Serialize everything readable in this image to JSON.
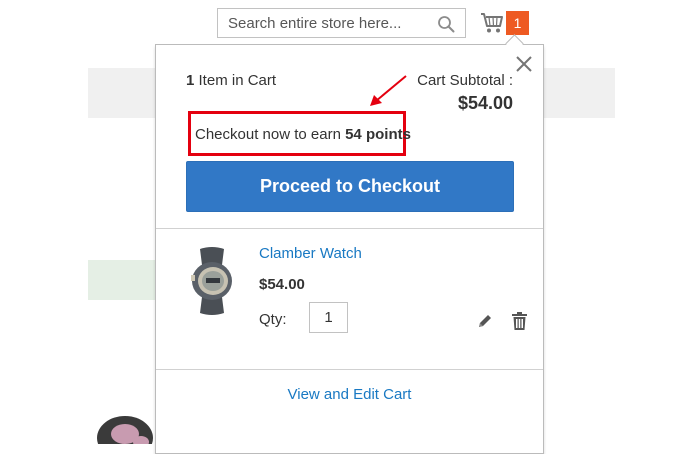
{
  "search": {
    "placeholder": "Search entire store here..."
  },
  "cart": {
    "badge_count": "1"
  },
  "minicart": {
    "items_count_number": "1",
    "items_count_label": "Item in Cart",
    "subtotal_label": "Cart Subtotal :",
    "subtotal_value": "$54.00",
    "points_prefix": "Checkout now to earn",
    "points_value": "54 points",
    "checkout_button": "Proceed to Checkout",
    "item": {
      "name": "Clamber Watch",
      "price": "$54.00",
      "qty_label": "Qty:",
      "qty_value": "1"
    },
    "view_cart_link": "View and Edit Cart"
  },
  "colors": {
    "accent_blue": "#3178c6",
    "link_blue": "#1979c3",
    "badge_orange": "#ee5a22",
    "annotation_red": "#e4000f"
  }
}
